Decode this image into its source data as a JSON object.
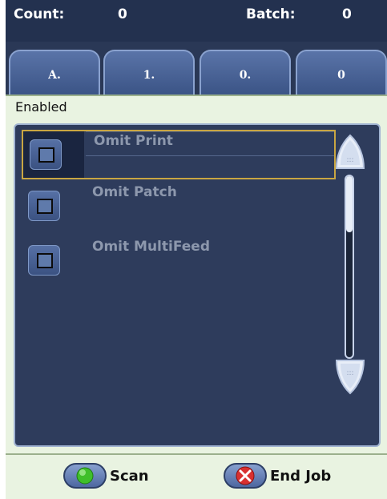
{
  "header": {
    "count_label": "Count:",
    "count_value": "0",
    "batch_label": "Batch:",
    "batch_value": "0"
  },
  "tabs": [
    {
      "label": "A."
    },
    {
      "label": "1."
    },
    {
      "label": "0."
    },
    {
      "label": "0"
    }
  ],
  "status": "Enabled",
  "options": [
    {
      "label": "Omit Print",
      "checked": false,
      "selected": true
    },
    {
      "label": "Omit Patch",
      "checked": false,
      "selected": false
    },
    {
      "label": "Omit MultiFeed",
      "checked": false,
      "selected": false
    }
  ],
  "icons": {
    "scroll_up": "chevron-up-icon",
    "scroll_down": "chevron-down-icon",
    "scan": "green-dot-icon",
    "end_job": "red-x-icon"
  },
  "footer": {
    "scan_label": "Scan",
    "end_job_label": "End Job"
  },
  "colors": {
    "background": "#2c3a58",
    "panel": "#e9f3e1",
    "selection": "#c9a642",
    "scan_green": "#3fbf2a",
    "end_red": "#d93030"
  }
}
